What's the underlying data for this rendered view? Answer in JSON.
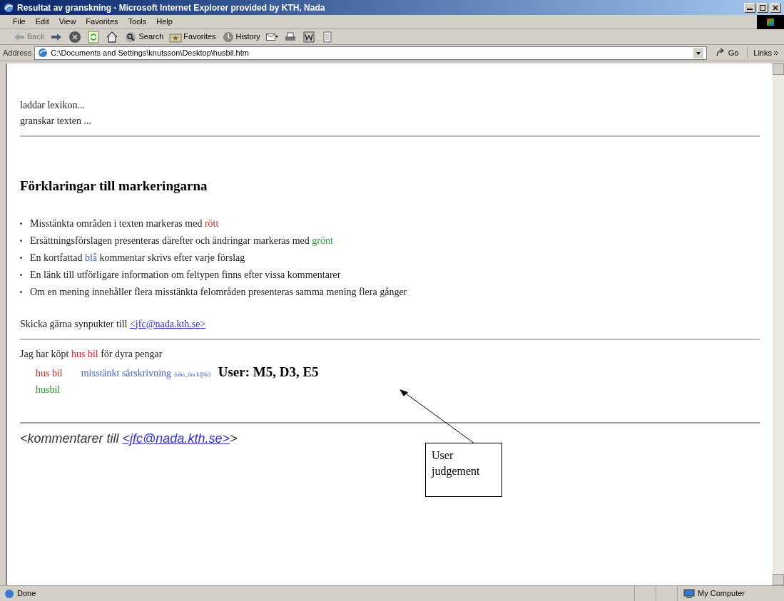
{
  "window": {
    "title": "Resultat av granskning - Microsoft Internet Explorer provided by KTH, Nada"
  },
  "menu": [
    "File",
    "Edit",
    "View",
    "Favorites",
    "Tools",
    "Help"
  ],
  "toolbar": [
    {
      "kind": "back",
      "label": "Back",
      "disabled": true
    },
    {
      "kind": "forward"
    },
    {
      "kind": "stop"
    },
    {
      "kind": "refresh"
    },
    {
      "kind": "home"
    },
    {
      "kind": "search",
      "label": "Search",
      "disabled": false
    },
    {
      "kind": "favorites",
      "label": "Favorites",
      "disabled": false
    },
    {
      "kind": "history",
      "label": "History",
      "disabled": false
    },
    {
      "kind": "mail"
    },
    {
      "kind": "print"
    },
    {
      "kind": "word"
    },
    {
      "kind": "discuss"
    }
  ],
  "address": {
    "label": "Address",
    "value": "C:\\Documents and Settings\\knutsson\\Desktop\\husbil.htm",
    "go": "Go",
    "links": "Links"
  },
  "page": {
    "status_lines": [
      "laddar lexikon...",
      "granskar texten ..."
    ],
    "heading": "Förklaringar till markeringarna",
    "bullets": [
      [
        {
          "text": "Misstänkta områden i texten markeras med "
        },
        {
          "text": "rött",
          "color": "#e02020"
        }
      ],
      [
        {
          "text": "Ersättningsförslagen presenteras därefter och ändringar markeras med "
        },
        {
          "text": "grönt",
          "color": "#2a9a2a"
        }
      ],
      [
        {
          "text": "En kortfattad "
        },
        {
          "text": "blå",
          "color": "#4060d0"
        },
        {
          "text": " kommentar skrivs efter varje förslag"
        }
      ],
      [
        {
          "text": "En länk till utförligare information om feltypen finns efter vissa kommentarer"
        }
      ],
      [
        {
          "text": "Om en mening innehåller flera misstänkta felområden presenteras samma mening flera gånger"
        }
      ]
    ],
    "feedback": {
      "text": "Skicka gärna synpukter till ",
      "link": "<jfc@nada.kth.se>"
    },
    "sentence": [
      {
        "text": "Jag har köpt "
      },
      {
        "text": "hus bil",
        "color": "#e02020"
      },
      {
        "text": " för dyra pengar"
      }
    ],
    "flagged": "hus bil",
    "comment": "misstänkt särskrivning",
    "comment_link": "(särs_mu.k@kt)",
    "judgement": "User: M5, D3, E5",
    "suggestion": "husbil",
    "footer": {
      "prefix": "<kommentarer till ",
      "link": "<jfc@nada.kth.se>",
      "suffix": ">"
    },
    "callout": "User judgement"
  },
  "status_bar": {
    "text": "Done",
    "zone": "My Computer"
  }
}
